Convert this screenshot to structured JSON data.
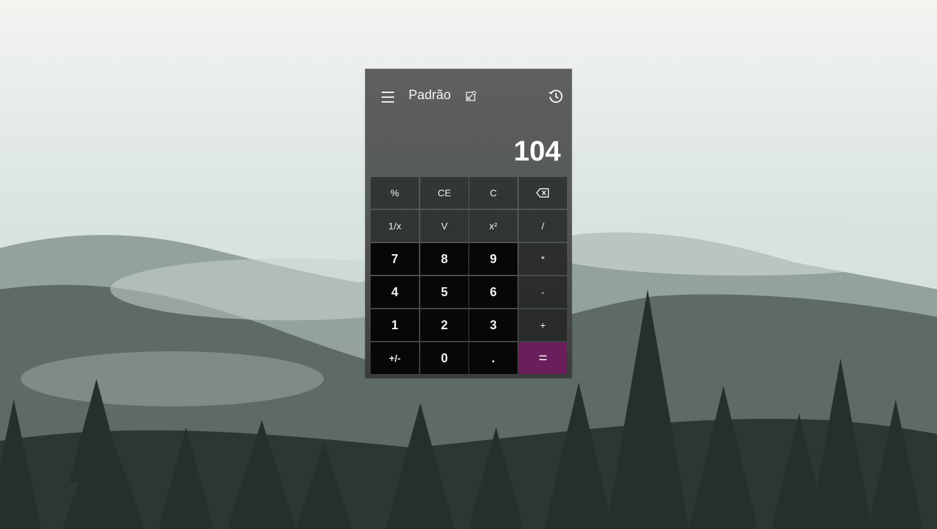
{
  "app": {
    "mode_title": "Padrão",
    "display_value": "104"
  },
  "icons": {
    "menu": "hamburger-menu-icon",
    "overlay": "keep-on-top-icon",
    "history": "history-icon",
    "backspace": "backspace-icon"
  },
  "colors": {
    "equals_accent": "#6a1e5c"
  },
  "keys": {
    "percent": "%",
    "clear_entry": "CE",
    "clear": "C",
    "reciprocal": "1/x",
    "sqrt": "V",
    "square": "x²",
    "divide": "/",
    "seven": "7",
    "eight": "8",
    "nine": "9",
    "multiply": "*",
    "four": "4",
    "five": "5",
    "six": "6",
    "minus": "-",
    "one": "1",
    "two": "2",
    "three": "3",
    "plus": "+",
    "negate": "+/-",
    "zero": "0",
    "decimal": ".",
    "equals": "="
  }
}
